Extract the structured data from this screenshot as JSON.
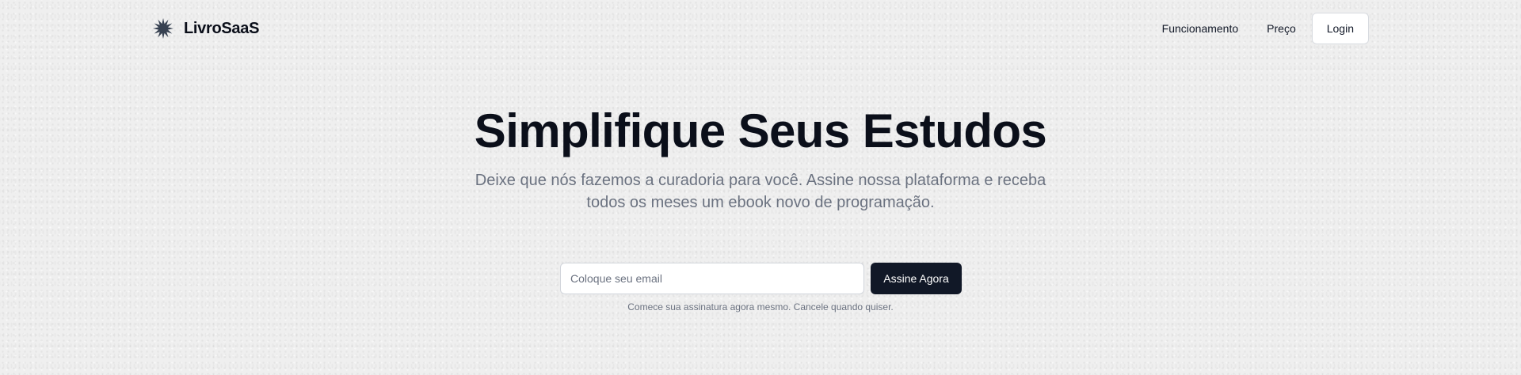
{
  "brand": {
    "name": "LivroSaaS",
    "icon": "star-burst-icon"
  },
  "nav": {
    "links": [
      "Funcionamento",
      "Preço"
    ],
    "login_label": "Login"
  },
  "hero": {
    "title": "Simplifique Seus Estudos",
    "subtitle": "Deixe que nós fazemos a curadoria para você. Assine nossa plataforma e receba todos os meses um ebook novo de programação."
  },
  "signup": {
    "email_placeholder": "Coloque seu email",
    "email_value": "",
    "button_label": "Assine Agora",
    "note": "Comece sua assinatura agora mesmo. Cancele quando quiser."
  },
  "colors": {
    "background": "#efefef",
    "primary": "#111827",
    "muted_text": "#6b7280"
  }
}
